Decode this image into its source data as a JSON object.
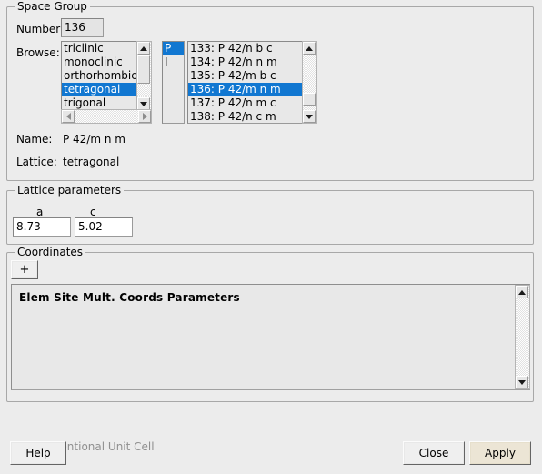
{
  "space_group": {
    "title": "Space Group",
    "number_label": "Number:",
    "number_value": "136",
    "browse_label": "Browse:",
    "crystal_systems": [
      {
        "label": "triclinic",
        "selected": false
      },
      {
        "label": "monoclinic",
        "selected": false
      },
      {
        "label": "orthorhombic",
        "selected": false
      },
      {
        "label": "tetragonal",
        "selected": true
      },
      {
        "label": "trigonal",
        "selected": false
      }
    ],
    "centerings": [
      {
        "label": "P",
        "selected": true
      },
      {
        "label": "I",
        "selected": false
      }
    ],
    "groups": [
      {
        "label": "133: P 42/n b c",
        "selected": false
      },
      {
        "label": "134: P 42/n n m",
        "selected": false
      },
      {
        "label": "135: P 42/m b c",
        "selected": false
      },
      {
        "label": "136: P 42/m n m",
        "selected": true
      },
      {
        "label": "137: P 42/n m c",
        "selected": false
      },
      {
        "label": "138: P 42/n c m",
        "selected": false
      }
    ],
    "name_label": "Name:",
    "name_value": "P 42/m n m",
    "lattice_label": "Lattice:",
    "lattice_value": "tetragonal"
  },
  "lattice_parameters": {
    "title": "Lattice parameters",
    "a_label": "a",
    "a_value": "8.73",
    "c_label": "c",
    "c_value": "5.02"
  },
  "coordinates": {
    "title": "Coordinates",
    "add_button_label": "+",
    "columns_header": "Elem Site Mult. Coords Parameters",
    "rows": []
  },
  "options": {
    "conventional_unit_cell_label": "Conventional Unit Cell",
    "conventional_unit_cell_checked": false
  },
  "buttons": {
    "help": "Help",
    "close": "Close",
    "apply": "Apply"
  },
  "colors": {
    "selection": "#1177d1",
    "selection_text": "#ffffff",
    "window_bg": "#ececec",
    "default_button_bg": "#ece5d5",
    "disabled_text": "#909090"
  }
}
